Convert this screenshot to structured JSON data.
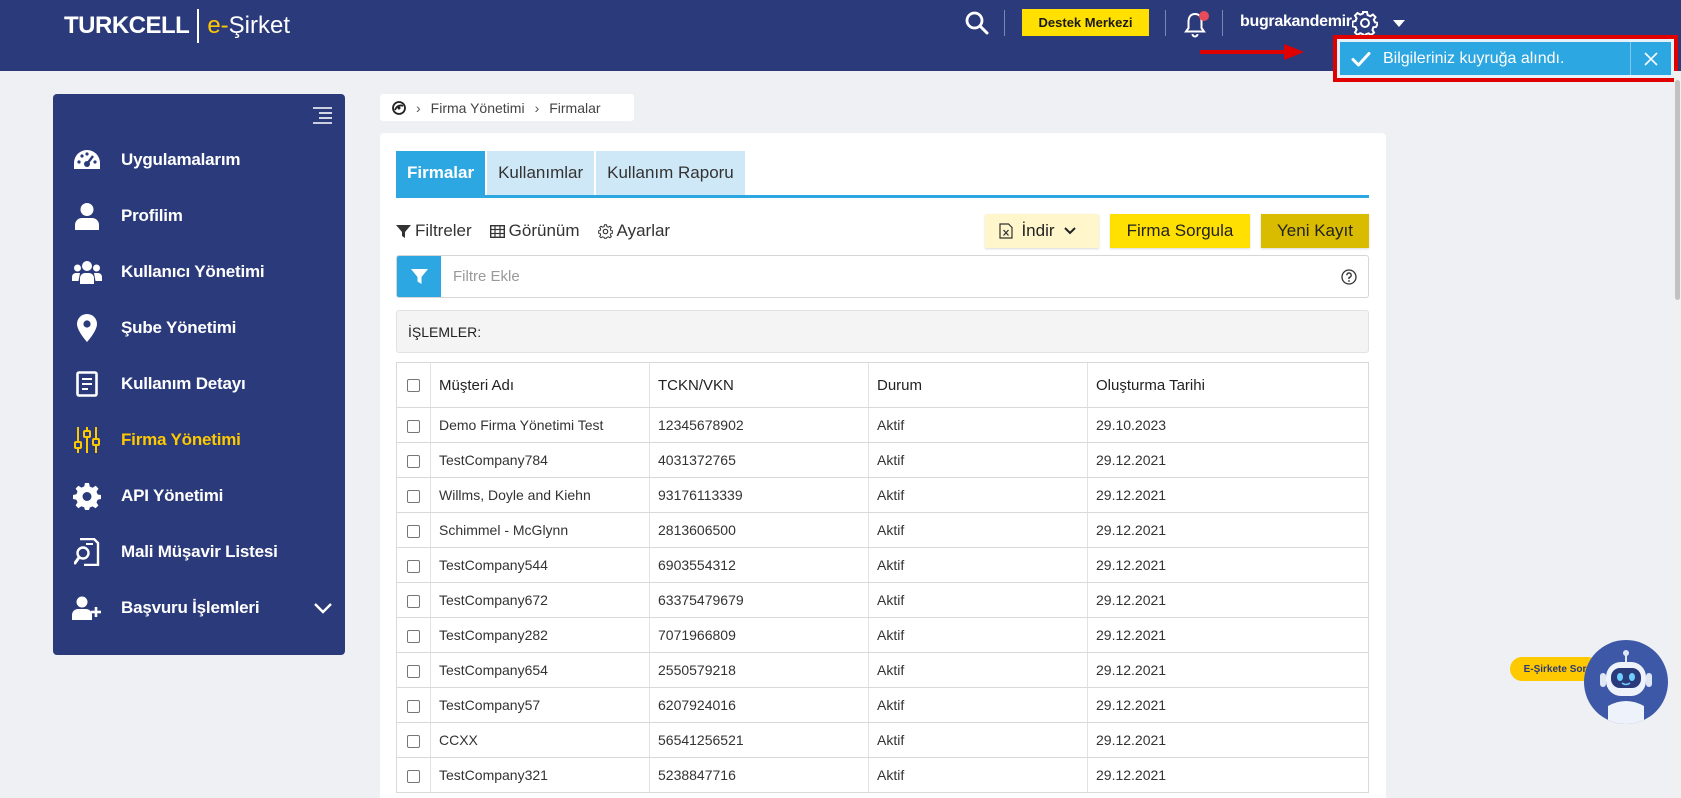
{
  "header": {
    "brand": "TURKCELL",
    "product_prefix": "e-",
    "product_name": "Şirket",
    "support_button": "Destek Merkezi",
    "username": "bugrakandemir",
    "icons": [
      "search-icon",
      "bell-icon",
      "gear-icon",
      "caret-down-icon"
    ],
    "brand_color": "#2b3a7a",
    "accent_color": "#ffc900"
  },
  "toast": {
    "message": "Bilgileriniz kuyruğa alındı.",
    "color": "#2da7e1",
    "highlight_color": "#e00000"
  },
  "sidebar": {
    "items": [
      {
        "label": "Uygulamalarım",
        "icon": "dashboard-icon"
      },
      {
        "label": "Profilim",
        "icon": "user-icon"
      },
      {
        "label": "Kullanıcı Yönetimi",
        "icon": "users-icon"
      },
      {
        "label": "Şube Yönetimi",
        "icon": "map-pin-icon"
      },
      {
        "label": "Kullanım Detayı",
        "icon": "document-icon"
      },
      {
        "label": "Firma Yönetimi",
        "icon": "sliders-icon",
        "active": true
      },
      {
        "label": "API Yönetimi",
        "icon": "gear-icon"
      },
      {
        "label": "Mali Müşavir Listesi",
        "icon": "doc-search-icon"
      },
      {
        "label": "Başvuru İşlemleri",
        "icon": "user-plus-icon",
        "expandable": true
      }
    ]
  },
  "breadcrumb": {
    "items": [
      "Firma Yönetimi",
      "Firmalar"
    ]
  },
  "tabs": [
    {
      "label": "Firmalar",
      "active": true
    },
    {
      "label": "Kullanımlar"
    },
    {
      "label": "Kullanım Raporu"
    }
  ],
  "toolbar": {
    "filters": "Filtreler",
    "view": "Görünüm",
    "settings": "Ayarlar",
    "download": "İndir",
    "query_company": "Firma Sorgula",
    "new_record": "Yeni Kayıt"
  },
  "filter": {
    "placeholder": "Filtre Ekle"
  },
  "operations_label": "İŞLEMLER:",
  "table": {
    "columns": [
      "Müşteri Adı",
      "TCKN/VKN",
      "Durum",
      "Oluşturma Tarihi"
    ],
    "rows": [
      [
        "Demo Firma Yönetimi Test",
        "12345678902",
        "Aktif",
        "29.10.2023"
      ],
      [
        "TestCompany784",
        "4031372765",
        "Aktif",
        "29.12.2021"
      ],
      [
        "Willms, Doyle and Kiehn",
        "93176113339",
        "Aktif",
        "29.12.2021"
      ],
      [
        "Schimmel - McGlynn",
        "2813606500",
        "Aktif",
        "29.12.2021"
      ],
      [
        "TestCompany544",
        "6903554312",
        "Aktif",
        "29.12.2021"
      ],
      [
        "TestCompany672",
        "63375479679",
        "Aktif",
        "29.12.2021"
      ],
      [
        "TestCompany282",
        "7071966809",
        "Aktif",
        "29.12.2021"
      ],
      [
        "TestCompany654",
        "2550579218",
        "Aktif",
        "29.12.2021"
      ],
      [
        "TestCompany57",
        "6207924016",
        "Aktif",
        "29.12.2021"
      ],
      [
        "CCXX",
        "56541256521",
        "Aktif",
        "29.12.2021"
      ],
      [
        "TestCompany321",
        "5238847716",
        "Aktif",
        "29.12.2021"
      ]
    ]
  },
  "bot": {
    "label": "E-Şirkete Sor"
  }
}
